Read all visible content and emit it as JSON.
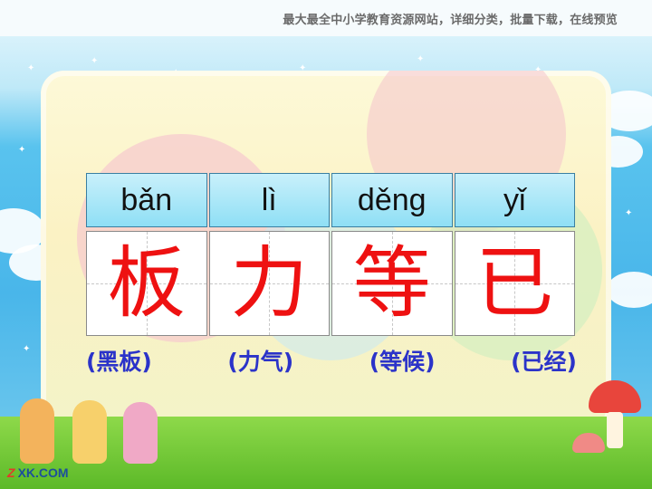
{
  "header": {
    "text": "最大最全中小学教育资源网站，详细分类，批量下载，在线预览"
  },
  "lesson": {
    "pinyin": [
      "bǎn",
      "lì",
      "děng",
      "yǐ"
    ],
    "characters": [
      "板",
      "力",
      "等",
      "已"
    ],
    "words": [
      "(黑板)",
      "(力气)",
      "(等候)",
      "(已经)"
    ]
  },
  "footer": {
    "logo_mark": "Z",
    "logo_text": "XK.COM"
  },
  "colors": {
    "sky": "#49b6ea",
    "board": "#fbf2c4",
    "pinyin_cell": "#8fdff5",
    "character": "#ee1111",
    "word": "#2b33c9",
    "grass": "#5cb928"
  }
}
